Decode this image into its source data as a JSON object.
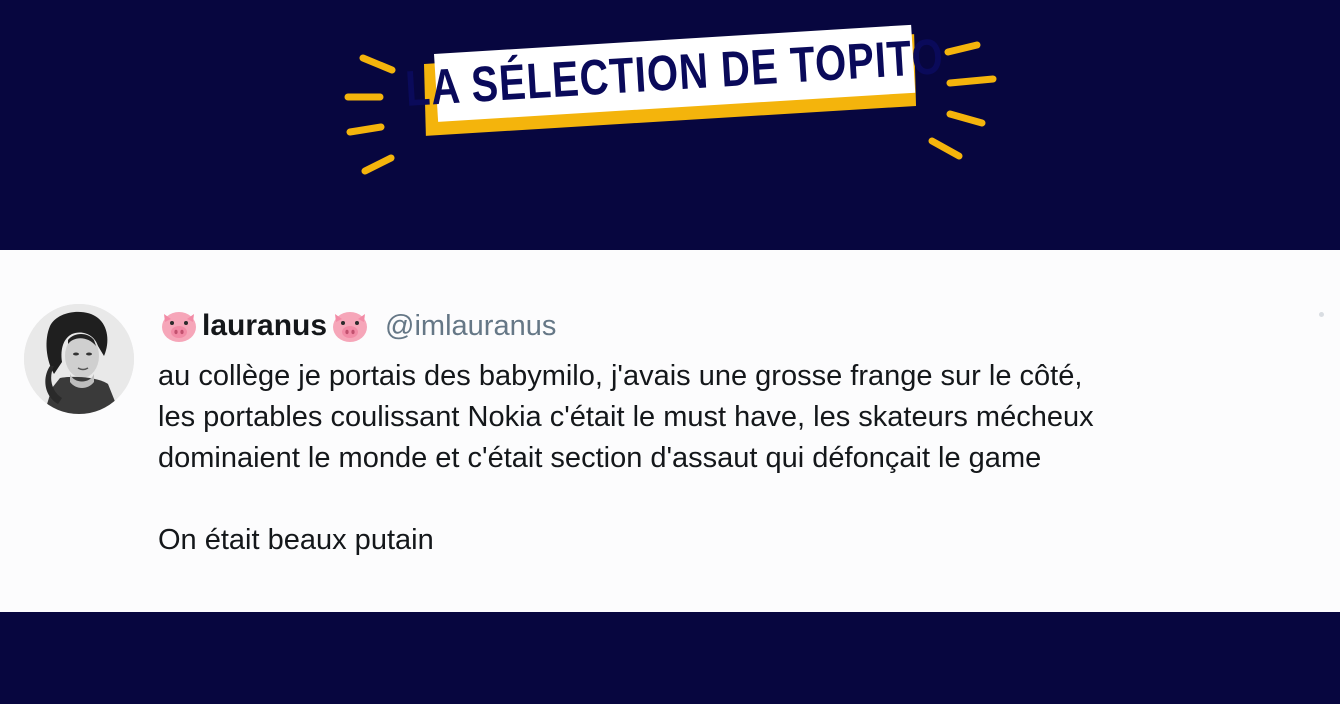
{
  "banner": {
    "title": "LA SÉLECTION DE TOPITO"
  },
  "tweet": {
    "display_name": "lauranus",
    "name_emoji": "pig-face-icon",
    "handle": "@imlauranus",
    "lines": [
      "au collège je portais des babymilo, j'avais une grosse frange sur le côté,",
      "les portables coulissant Nokia c'était le must have, les skateurs mécheux",
      "dominaient le monde et c'était section d'assaut qui défonçait le game",
      "On était beaux putain"
    ]
  },
  "colors": {
    "background": "#07063f",
    "accent": "#f4b40c",
    "logo_text": "#0a0a5a",
    "card": "#fcfcfd",
    "handle": "#657786"
  }
}
